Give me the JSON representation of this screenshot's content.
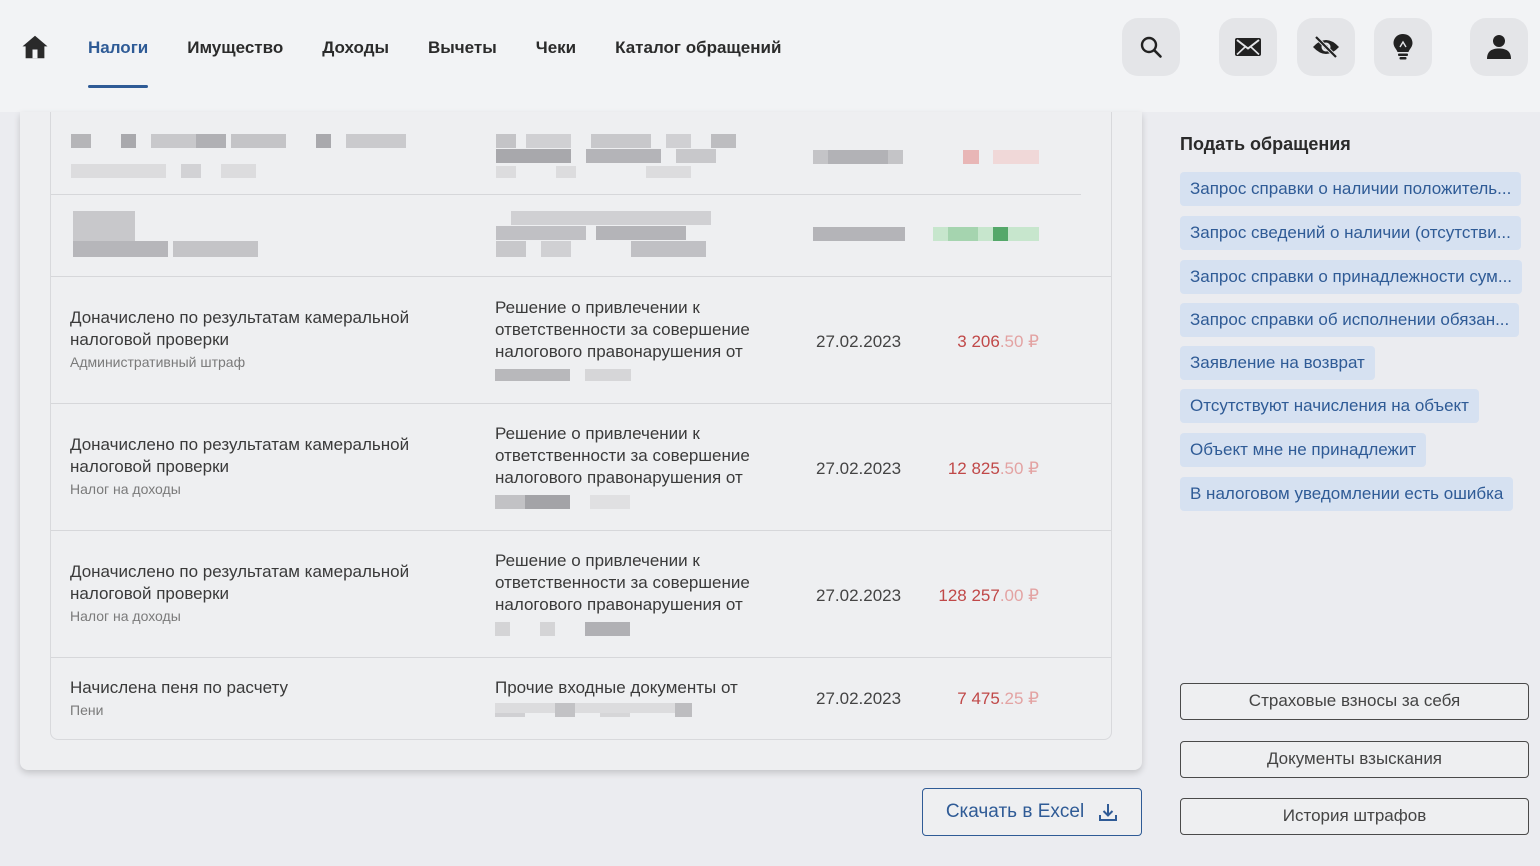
{
  "nav": {
    "items": [
      {
        "label": "Налоги",
        "active": true
      },
      {
        "label": "Имущество",
        "active": false
      },
      {
        "label": "Доходы",
        "active": false
      },
      {
        "label": "Вычеты",
        "active": false
      },
      {
        "label": "Чеки",
        "active": false
      },
      {
        "label": "Каталог обращений",
        "active": false
      }
    ],
    "icons": [
      "home-icon",
      "search-icon",
      "mail-icon",
      "eye-off-icon",
      "lightbulb-icon",
      "user-icon"
    ]
  },
  "table": {
    "rows": [
      {
        "title_line1": "Доначислено по результатам камеральной",
        "title_line2": "налоговой проверки",
        "subtitle": "Административный штраф",
        "doc_line1": "Решение о привлечении к",
        "doc_line2": "ответственности за совершение",
        "doc_line3": "налогового правонарушения от",
        "date": "27.02.2023",
        "sum_int": "3 206",
        "sum_frac": ".50 ₽"
      },
      {
        "title_line1": "Доначислено по результатам камеральной",
        "title_line2": "налоговой проверки",
        "subtitle": "Налог на доходы",
        "doc_line1": "Решение о привлечении к",
        "doc_line2": "ответственности за совершение",
        "doc_line3": "налогового правонарушения от",
        "date": "27.02.2023",
        "sum_int": "12 825",
        "sum_frac": ".50 ₽"
      },
      {
        "title_line1": "Доначислено по результатам камеральной",
        "title_line2": "налоговой проверки",
        "subtitle": "Налог на доходы",
        "doc_line1": "Решение о привлечении к",
        "doc_line2": "ответственности за совершение",
        "doc_line3": "налогового правонарушения от",
        "date": "27.02.2023",
        "sum_int": "128 257",
        "sum_frac": ".00 ₽"
      },
      {
        "title_line1": "Начислена пеня по расчету",
        "subtitle": "Пени",
        "doc_line1": "Прочие входные документы от",
        "date": "27.02.2023",
        "sum_int": "7 475",
        "sum_frac": ".25 ₽"
      }
    ]
  },
  "panel": {
    "title": "Подать обращения",
    "chips": [
      "Запрос справки о наличии положитель...",
      "Запрос сведений о наличии (отсутстви...",
      "Запрос справки о принадлежности сум...",
      "Запрос справки об исполнении обязан...",
      "Заявление на возврат",
      "Отсутствуют начисления на объект",
      "Объект мне не принадлежит",
      "В налоговом уведомлении есть ошибка"
    ],
    "buttons": [
      "Страховые взносы за себя",
      "Документы взыскания",
      "История штрафов"
    ]
  },
  "excel_button": {
    "label": "Скачать в Excel"
  },
  "colors": {
    "accent": "#2f5b96",
    "chip_bg": "#d6e1f1",
    "sum_red": "#c04848",
    "background": "#ebecf0"
  }
}
